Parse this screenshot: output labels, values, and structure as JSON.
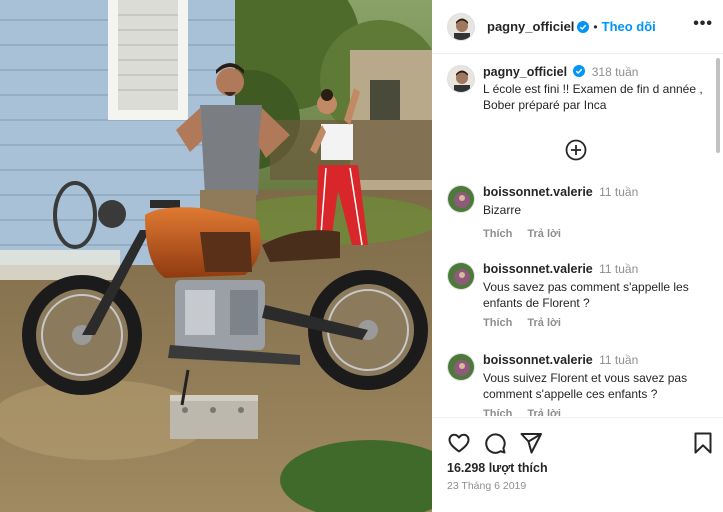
{
  "post": {
    "username": "pagny_officiel",
    "dot": "•",
    "follow_label": "Theo dõi",
    "more_icon": "more-horizontal-icon",
    "verified_icon": "verified-badge-icon"
  },
  "caption": {
    "username": "pagny_officiel",
    "age": "318 tuần",
    "text": "L école est fini !! Examen de fin d année , Bober préparé par Inca"
  },
  "load_more_icon": "plus-circle-icon",
  "comments": [
    {
      "username": "boissonnet.valerie",
      "age": "11 tuần",
      "text": "Bizarre",
      "like_label": "Thích",
      "reply_label": "Trả lời"
    },
    {
      "username": "boissonnet.valerie",
      "age": "11 tuần",
      "text": "Vous savez pas comment s'appelle les enfants de Florent ?",
      "like_label": "Thích",
      "reply_label": "Trả lời"
    },
    {
      "username": "boissonnet.valerie",
      "age": "11 tuần",
      "text": "Vous suivez Florent et vous savez pas comment s'appelle ces enfants ?",
      "like_label": "Thích",
      "reply_label": "Trả lời"
    }
  ],
  "actions": {
    "icons": [
      "heart-icon",
      "comment-icon",
      "share-icon",
      "bookmark-icon"
    ],
    "likes": "16.298 lượt thích",
    "date": "23 Tháng 6 2019"
  },
  "colors": {
    "accent": "#0095f6",
    "text": "#262626",
    "muted": "#8e8e8e",
    "motorcycle_tank": "#c2561d"
  }
}
